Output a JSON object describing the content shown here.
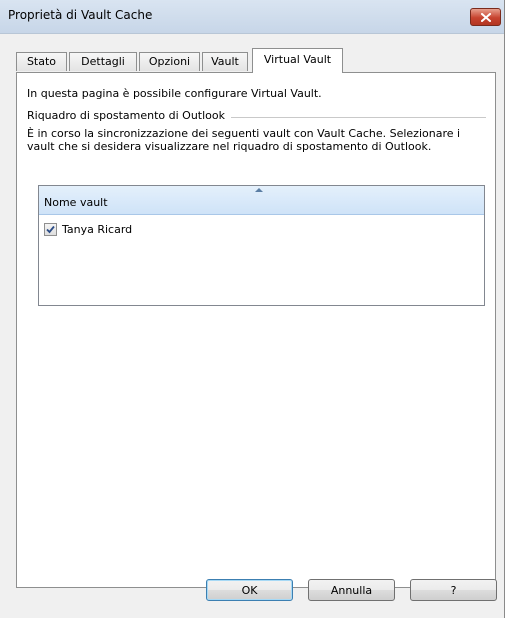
{
  "window": {
    "title": "Proprietà di Vault Cache",
    "close_icon": "close-icon",
    "accent_close": "#c7432f"
  },
  "tabs": [
    {
      "label": "Stato",
      "active": false
    },
    {
      "label": "Dettagli",
      "active": false
    },
    {
      "label": "Opzioni",
      "active": false
    },
    {
      "label": "Vault",
      "active": false
    },
    {
      "label": "Virtual Vault",
      "active": true
    }
  ],
  "panel": {
    "intro": "In questa pagina è possibile configurare Virtual Vault.",
    "group_label": "Riquadro di spostamento di Outlook",
    "description": "È in corso la sincronizzazione dei seguenti vault con Vault Cache. Selezionare i vault che si desidera visualizzare nel riquadro di spostamento di Outlook.",
    "list": {
      "column_header": "Nome vault",
      "items": [
        {
          "label": "Tanya Ricard",
          "checked": true
        }
      ]
    }
  },
  "buttons": {
    "ok": "OK",
    "cancel": "Annulla",
    "help": "?"
  }
}
